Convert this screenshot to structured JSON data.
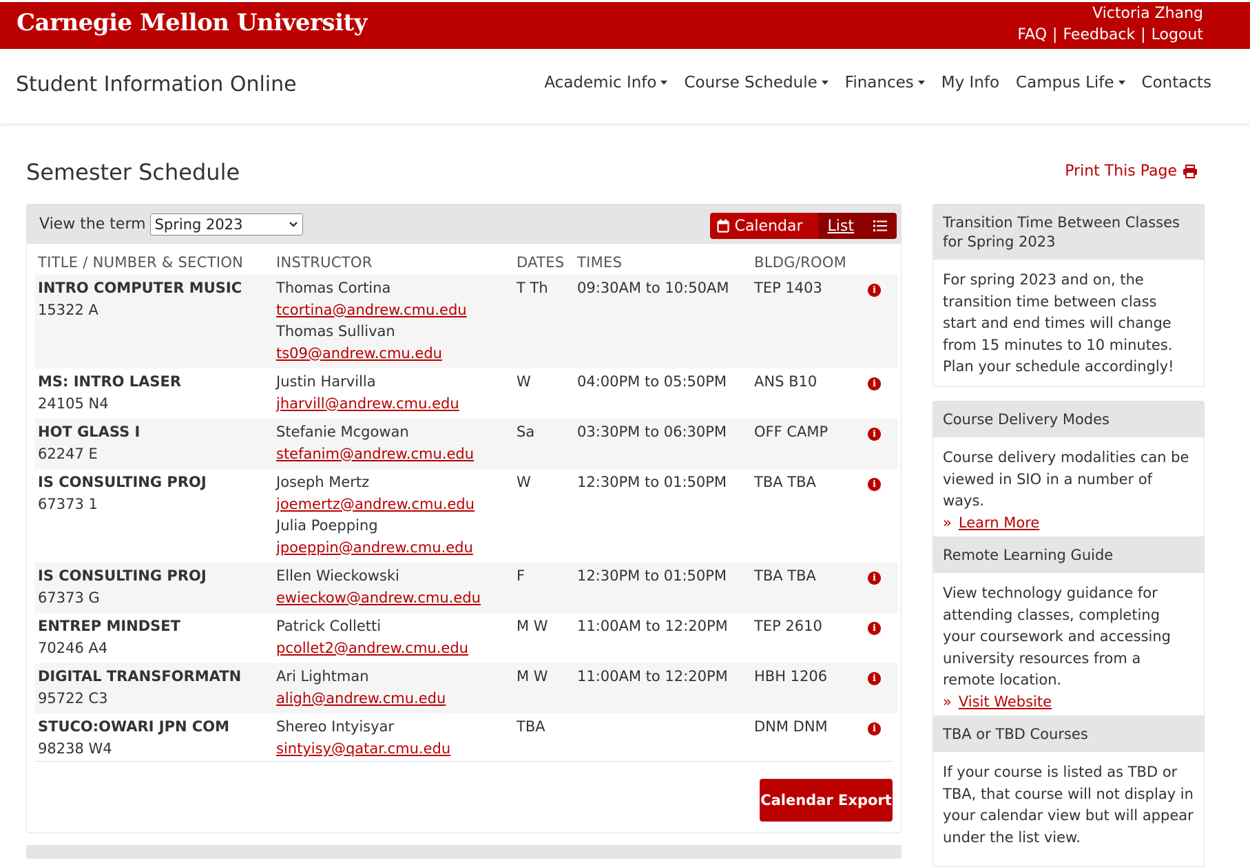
{
  "header": {
    "logo": "Carnegie Mellon University",
    "user_name": "Victoria Zhang",
    "links": [
      "FAQ",
      "Feedback",
      "Logout"
    ]
  },
  "nav": {
    "brand": "Student Information Online",
    "menu": [
      {
        "label": "Academic Info",
        "dropdown": true
      },
      {
        "label": "Course Schedule",
        "dropdown": true
      },
      {
        "label": "Finances",
        "dropdown": true
      },
      {
        "label": "My Info",
        "dropdown": false
      },
      {
        "label": "Campus Life",
        "dropdown": true
      },
      {
        "label": "Contacts",
        "dropdown": false
      }
    ]
  },
  "page": {
    "title": "Semester Schedule",
    "print_label": "Print This Page"
  },
  "schedule": {
    "term_label": "View the term",
    "term_selected": "Spring 2023",
    "view_calendar": "Calendar",
    "view_list": "List",
    "columns": [
      "TITLE / NUMBER & SECTION",
      "INSTRUCTOR",
      "DATES",
      "TIMES",
      "BLDG/ROOM"
    ],
    "rows": [
      {
        "title": "INTRO COMPUTER MUSIC",
        "number": "15322 A",
        "instructors": [
          {
            "name": "Thomas Cortina",
            "email": "tcortina@andrew.cmu.edu"
          },
          {
            "name": "Thomas Sullivan",
            "email": "ts09@andrew.cmu.edu"
          }
        ],
        "dates": "T Th",
        "times": "09:30AM to 10:50AM",
        "room": "TEP 1403"
      },
      {
        "title": "MS: INTRO LASER",
        "number": "24105 N4",
        "instructors": [
          {
            "name": "Justin Harvilla",
            "email": "jharvill@andrew.cmu.edu"
          }
        ],
        "dates": "W",
        "times": "04:00PM to 05:50PM",
        "room": "ANS B10"
      },
      {
        "title": "HOT GLASS I",
        "number": "62247 E",
        "instructors": [
          {
            "name": "Stefanie Mcgowan",
            "email": "stefanim@andrew.cmu.edu"
          }
        ],
        "dates": "Sa",
        "times": "03:30PM to 06:30PM",
        "room": "OFF CAMP"
      },
      {
        "title": "IS CONSULTING PROJ",
        "number": "67373 1",
        "instructors": [
          {
            "name": "Joseph Mertz",
            "email": "joemertz@andrew.cmu.edu"
          },
          {
            "name": "Julia Poepping",
            "email": "jpoeppin@andrew.cmu.edu"
          }
        ],
        "dates": "W",
        "times": "12:30PM to 01:50PM",
        "room": "TBA TBA"
      },
      {
        "title": "IS CONSULTING PROJ",
        "number": "67373 G",
        "instructors": [
          {
            "name": "Ellen Wieckowski",
            "email": "ewieckow@andrew.cmu.edu"
          }
        ],
        "dates": "F",
        "times": "12:30PM to 01:50PM",
        "room": "TBA TBA"
      },
      {
        "title": "ENTREP MINDSET",
        "number": "70246 A4",
        "instructors": [
          {
            "name": "Patrick Colletti",
            "email": "pcollet2@andrew.cmu.edu"
          }
        ],
        "dates": "M W",
        "times": "11:00AM to 12:20PM",
        "room": "TEP 2610"
      },
      {
        "title": "DIGITAL TRANSFORMATN",
        "number": "95722 C3",
        "instructors": [
          {
            "name": "Ari Lightman",
            "email": "aligh@andrew.cmu.edu"
          }
        ],
        "dates": "M W",
        "times": "11:00AM to 12:20PM",
        "room": "HBH 1206"
      },
      {
        "title": "STUCO:OWARI JPN COM",
        "number": "98238 W4",
        "instructors": [
          {
            "name": "Shereo Intyisyar",
            "email": "sintyisy@qatar.cmu.edu"
          }
        ],
        "dates": "TBA",
        "times": "",
        "room": "DNM DNM"
      }
    ],
    "export_label": "Calendar Export"
  },
  "sidebar": [
    {
      "title": "Transition Time Between Classes for Spring 2023",
      "body": "For spring 2023 and on, the transition time between class start and end times will change from 15 minutes to 10 minutes. Plan your schedule accordingly!",
      "link": ""
    },
    {
      "title": "Course Delivery Modes",
      "body": "Course delivery modalities can be viewed in SIO in a number of ways.",
      "link": "Learn More"
    },
    {
      "title": "Remote Learning Guide",
      "body": "View technology guidance for attending classes, completing your coursework and accessing university resources from a remote location.",
      "link": "Visit Website"
    },
    {
      "title": "TBA or TBD Courses",
      "body": "If your course is listed as TBD or TBA, that course will not display in your calendar view but will appear under the list view.",
      "link": ""
    }
  ],
  "colors": {
    "brand_red": "#bb0000",
    "dark_red": "#8c0000",
    "panel_gray": "#e5e5e5"
  }
}
